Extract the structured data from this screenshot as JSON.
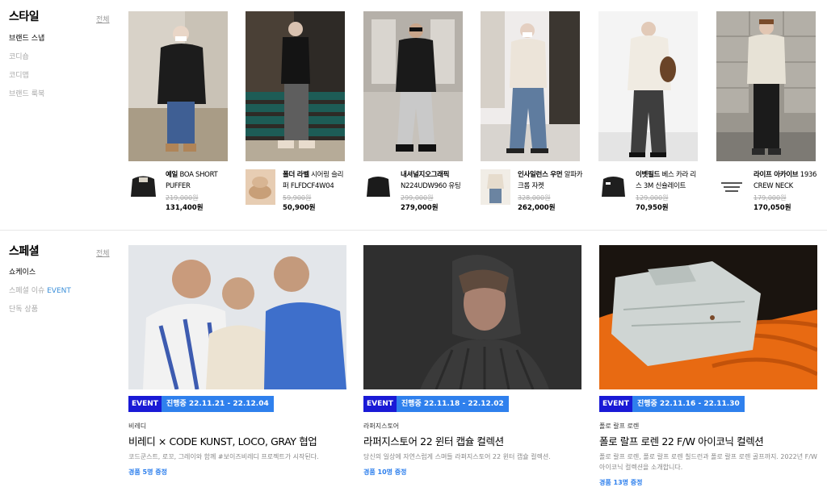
{
  "style": {
    "title": "스타일",
    "all_label": "전체",
    "menu": [
      "브랜드 스냅",
      "코디숍",
      "코디맵",
      "브랜드 룩북"
    ],
    "snaps": [
      {
        "name_bold": "예일",
        "name_rest": " BOA SHORT PUFFER",
        "orig_price": "219,000원",
        "price": "131,400원"
      },
      {
        "name_bold": "폴더 라벨",
        "name_rest": " 시어링 슬리퍼 FLFDCF4W04",
        "orig_price": "59,900원",
        "price": "50,900원"
      },
      {
        "name_bold": "내셔널지오그래픽",
        "name_rest": " N224UDW960 유팅",
        "orig_price": "299,000원",
        "price": "279,000원"
      },
      {
        "name_bold": "인사일런스 우먼",
        "name_rest": " 알파카 크롭 자켓",
        "orig_price": "328,000원",
        "price": "262,000원"
      },
      {
        "name_bold": "이벳필드",
        "name_rest": " 베스 카라 리스 3M 신슐레이트",
        "orig_price": "129,000원",
        "price": "70,950원"
      },
      {
        "name_bold": "라이프 아카이브",
        "name_rest": " 1936 CREW NECK",
        "orig_price": "179,000원",
        "price": "170,050원"
      }
    ]
  },
  "special": {
    "title": "스페셜",
    "all_label": "전체",
    "menu": [
      {
        "label": "쇼케이스",
        "accent": ""
      },
      {
        "label": "스페셜 이슈 ",
        "accent": "EVENT"
      },
      {
        "label": "단독 상품",
        "accent": ""
      }
    ],
    "cards": [
      {
        "badge": "EVENT",
        "status": "진행중  22.11.21 - 22.12.04",
        "brand": "비레디",
        "title": "비레디 × CODE KUNST, LOCO, GRAY 협업",
        "desc": "코드쿤스트, 로꼬, 그레이와 함께 #보이즈비레디 프로젝트가 시작된다.",
        "gift": "경품 5명 증정"
      },
      {
        "badge": "EVENT",
        "status": "진행중  22.11.18 - 22.12.02",
        "brand": "라퍼지스토어",
        "title": "라퍼지스토어 22 윈터 캡슐 컬렉션",
        "desc": "당신의 일상에 자연스럽게 스며들 라퍼지스토어 22 윈터 캡슐 컬렉션.",
        "gift": "경품 10명 증정"
      },
      {
        "badge": "EVENT",
        "status": "진행중  22.11.16 - 22.11.30",
        "brand": "폴로 랄프 로렌",
        "title": "폴로 랄프 로렌 22 F/W 아이코닉 컬렉션",
        "desc": "폴로 랄프 로렌, 폴로 랄프 로렌 칠드런과 폴로 랄프 로렌 골프까지. 2022년 F/W 아이코닉 컬렉션을 소개합니다.",
        "gift": "경품 13명 증정"
      }
    ]
  },
  "colors": {
    "event_badge": "#1a1ad6",
    "status_badge": "#2f80ed",
    "accent": "#3b8fd9"
  }
}
